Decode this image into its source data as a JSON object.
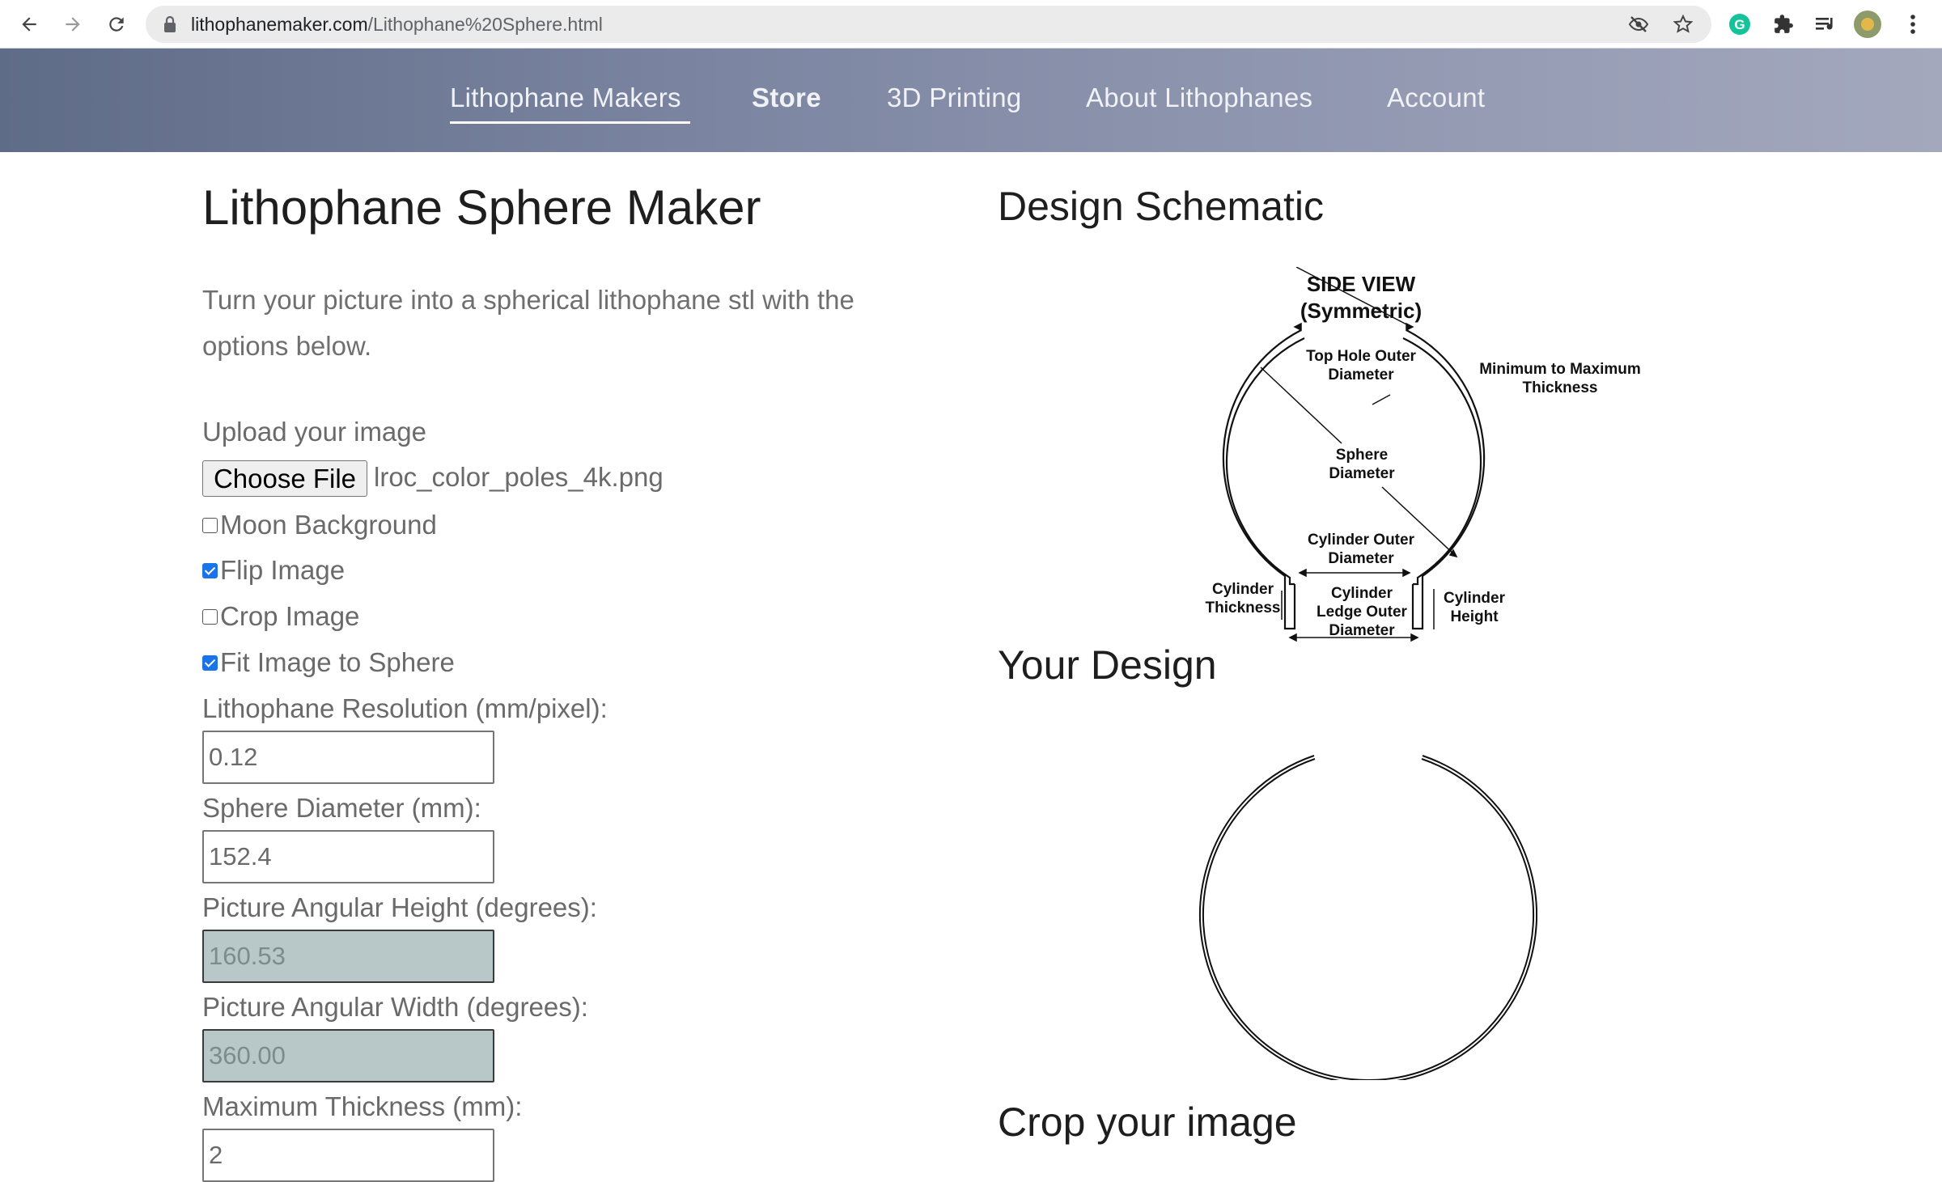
{
  "browser": {
    "url_host": "lithophanemaker.com",
    "url_path": "/Lithophane%20Sphere.html",
    "icons": [
      "back-arrow-icon",
      "forward-arrow-icon",
      "reload-icon",
      "lock-icon",
      "eye-slash-icon",
      "star-icon",
      "grammarly-icon",
      "puzzle-icon",
      "media-queue-icon",
      "profile-avatar-icon",
      "more-vert-icon"
    ]
  },
  "nav": {
    "items": [
      {
        "label": "Lithophane Makers",
        "active": true
      },
      {
        "label": "Store",
        "bold": true
      },
      {
        "label": "3D Printing"
      },
      {
        "label": "About Lithophanes"
      },
      {
        "label": "Account"
      }
    ]
  },
  "page": {
    "title": "Lithophane Sphere Maker",
    "intro": "Turn your picture into a spherical lithophane stl with the options below.",
    "upload_label": "Upload your image",
    "choose_file_label": "Choose File",
    "file_name": "lroc_color_poles_4k.png",
    "checkboxes": [
      {
        "label": "Moon Background",
        "checked": false
      },
      {
        "label": "Flip Image",
        "checked": true
      },
      {
        "label": "Crop Image",
        "checked": false
      },
      {
        "label": "Fit Image to Sphere",
        "checked": true
      }
    ],
    "fields": [
      {
        "label": "Lithophane Resolution (mm/pixel):",
        "value": "0.12",
        "readonly": false
      },
      {
        "label": "Sphere Diameter (mm):",
        "value": "152.4",
        "readonly": false
      },
      {
        "label": "Picture Angular Height (degrees):",
        "value": "160.53",
        "readonly": true
      },
      {
        "label": "Picture Angular Width (degrees):",
        "value": "360.00",
        "readonly": true
      },
      {
        "label": "Maximum Thickness (mm):",
        "value": "2",
        "readonly": false
      }
    ]
  },
  "right": {
    "schematic_title": "Design Schematic",
    "your_design_title": "Your Design",
    "crop_title": "Crop your image",
    "schematic": {
      "side_view": "SIDE VIEW",
      "symmetric": "(Symmetric)",
      "top_hole_1": "Top Hole Outer",
      "top_hole_2": "Diameter",
      "min_max_1": "Minimum to Maximum",
      "min_max_2": "Thickness",
      "sphere_1": "Sphere",
      "sphere_2": "Diameter",
      "cyl_outer_1": "Cylinder Outer",
      "cyl_outer_2": "Diameter",
      "cyl_thick_1": "Cylinder",
      "cyl_thick_2": "Thickness",
      "ledge_1": "Cylinder",
      "ledge_2": "Ledge Outer",
      "ledge_3": "Diameter",
      "cyl_height_1": "Cylinder",
      "cyl_height_2": "Height"
    }
  },
  "colors": {
    "header_gradient_start": "#5f6c87",
    "header_gradient_end": "#a3a8bd",
    "readonly_field_bg": "#b8c8c8",
    "checkbox_accent": "#1a73e8"
  }
}
